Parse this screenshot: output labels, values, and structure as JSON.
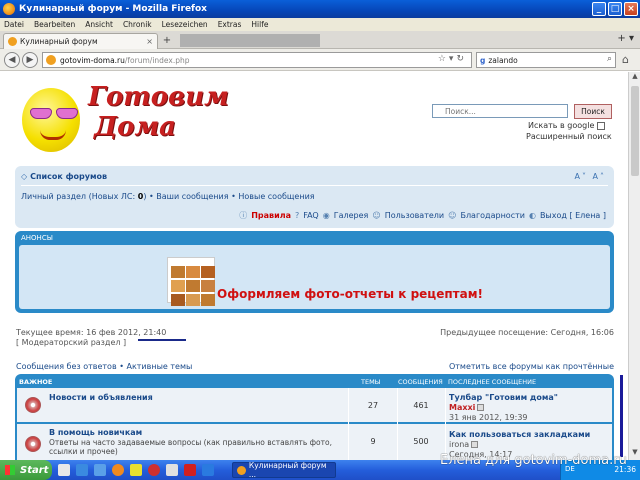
{
  "window": {
    "title": "Кулинарный форум - Mozilla Firefox",
    "menu": [
      "Datei",
      "Bearbeiten",
      "Ansicht",
      "Chronik",
      "Lesezeichen",
      "Extras",
      "Hilfe"
    ]
  },
  "tabs": [
    {
      "label": "Кулинарный форум",
      "close": "×"
    }
  ],
  "toolbar": {
    "new_tab": "+",
    "url_host": "gotovim-doma.ru",
    "url_path": "/forum/index.php",
    "search_engine": "g",
    "search_value": "zalando"
  },
  "site": {
    "logo_line1": "Готовим",
    "logo_line2": "Дома",
    "search_placeholder": "Поиск...",
    "search_button": "Поиск",
    "search_google": "Искать в google",
    "advanced_search": "Расширенный поиск"
  },
  "nav": {
    "forum_list": "Список форумов",
    "personal": "Личный раздел (Новых ЛС: ",
    "personal_count": "0",
    "personal_end": ")",
    "my_posts": "• Ваши сообщения",
    "new_posts": "• Новые сообщения",
    "rules": "Правила",
    "faq": "FAQ",
    "gallery": "Галерея",
    "users": "Пользователи",
    "thanks": "Благодарности",
    "logout": "Выход [ Елена ]"
  },
  "announcements": {
    "header": "АНОНСЫ",
    "promo": "Оформляем фото-отчеты к рецептам!"
  },
  "status": {
    "current_time": "Текущее время: 16 фев 2012, 21:40",
    "last_visit": "Предыдущее посещение: Сегодня, 16:06",
    "mod_section": "[ Модераторский раздел ]",
    "unanswered": "Сообщения без ответов • Активные темы",
    "mark_read": "Отметить все форумы как прочтённые"
  },
  "forum_table": {
    "headers": {
      "main": "ВАЖНОЕ",
      "topics": "ТЕМЫ",
      "posts": "СООБЩЕНИЯ",
      "last": "ПОСЛЕДНЕЕ СООБЩЕНИЕ"
    },
    "rows": [
      {
        "title": "Новости и объявления",
        "desc": "",
        "topics": "27",
        "posts": "461",
        "last_title": "Тулбар \"Готовим дома\"",
        "last_user": "Maxxi",
        "last_date": "31 янв 2012, 19:39"
      },
      {
        "title": "В помощь новичкам",
        "desc": "Ответы на часто задаваемые вопросы (как правильно вставлять фото, ссылки и прочее)",
        "topics": "9",
        "posts": "500",
        "last_title": "Как пользоваться закладками",
        "last_user": "irona",
        "last_date": "Сегодня, 14:17"
      }
    ]
  },
  "taskbar": {
    "start": "Start",
    "window_button": "Кулинарный форум ...",
    "lang": "DE",
    "clock": "21:36"
  },
  "watermark": "Елена для gotovim-doma.ru",
  "colors": {
    "accent": "#2a8ac8",
    "nav_bg": "#dbe8f3",
    "promo_red": "#d01010",
    "xp_blue": "#245edb"
  }
}
